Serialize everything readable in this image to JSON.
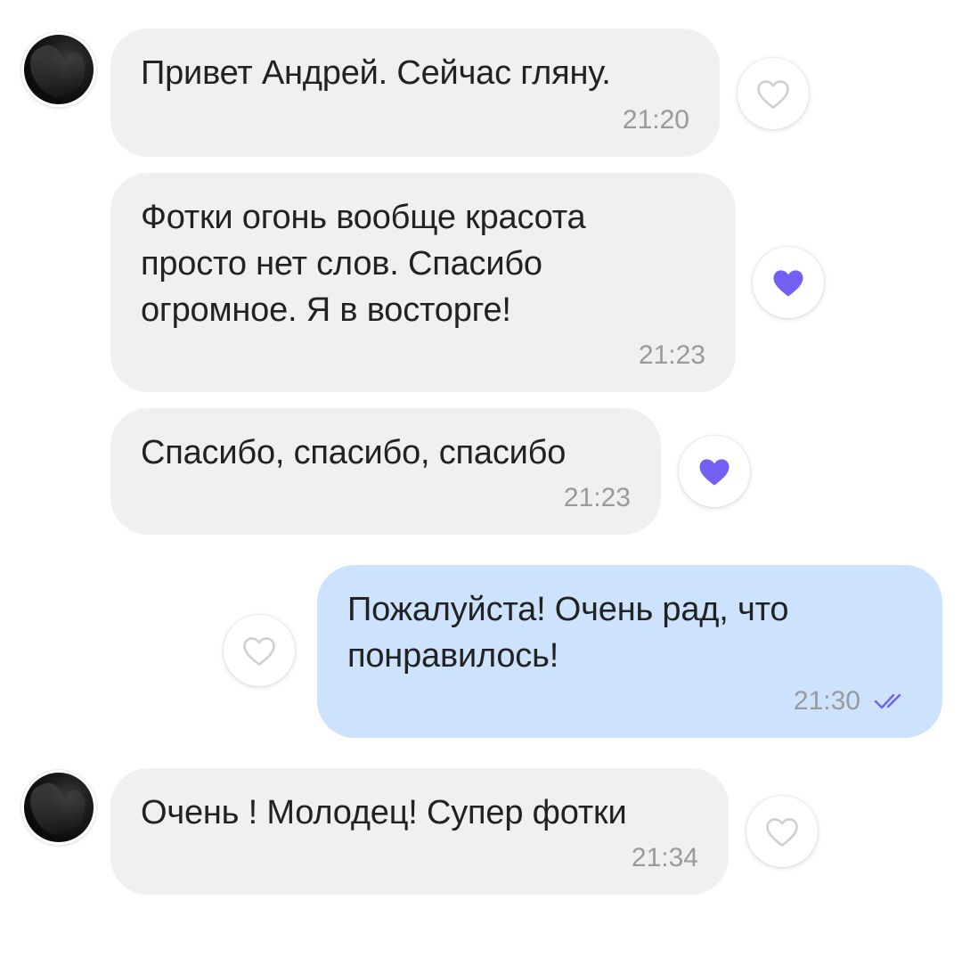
{
  "colors": {
    "incoming_bubble": "#f0f0f0",
    "outgoing_bubble": "#cde3fd",
    "liked_heart": "#7360f2",
    "empty_heart": "#cfcfcf",
    "read_check": "#7360f2",
    "time_text": "#9a9a9a"
  },
  "messages": [
    {
      "direction": "incoming",
      "text": "Привет Андрей. Сейчас гляну.",
      "time": "21:20",
      "reaction": "heart-outline-icon",
      "liked": false
    },
    {
      "direction": "incoming",
      "text": "Фотки огонь вообще красота\nпросто нет слов. Спасибо\nогромное. Я в восторге!",
      "time": "21:23",
      "reaction": "heart-filled-icon",
      "liked": true
    },
    {
      "direction": "incoming",
      "text": "Спасибо, спасибо, спасибо",
      "time": "21:23",
      "reaction": "heart-filled-icon",
      "liked": true
    },
    {
      "direction": "outgoing",
      "text": "Пожалуйста! Очень рад, что\nпонравилось!",
      "time": "21:30",
      "status_icon": "double-check-icon",
      "reaction": "heart-outline-icon",
      "liked": false
    },
    {
      "direction": "incoming",
      "text": "Очень ! Молодец! Супер фотки",
      "time": "21:34",
      "reaction": "heart-outline-icon",
      "liked": false
    }
  ]
}
